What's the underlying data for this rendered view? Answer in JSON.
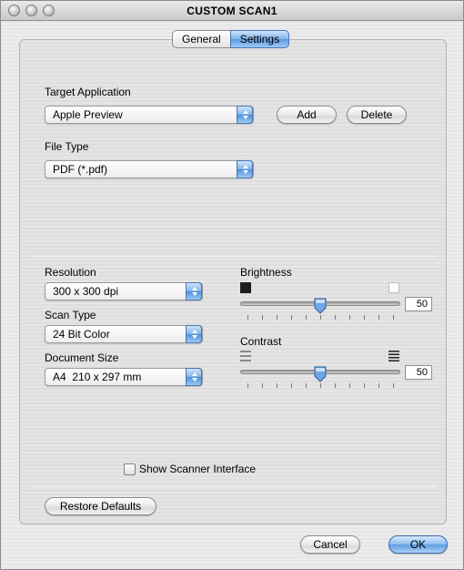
{
  "window": {
    "title": "CUSTOM SCAN1"
  },
  "tabs": [
    {
      "label": "General",
      "selected": false
    },
    {
      "label": "Settings",
      "selected": true
    }
  ],
  "target_application": {
    "label": "Target Application",
    "value": "Apple Preview",
    "add": "Add",
    "delete": "Delete"
  },
  "file_type": {
    "label": "File Type",
    "value": "PDF (*.pdf)"
  },
  "resolution": {
    "label": "Resolution",
    "value": "300 x 300 dpi"
  },
  "scan_type": {
    "label": "Scan Type",
    "value": "24 Bit Color"
  },
  "document_size": {
    "label": "Document Size",
    "value": "A4  210 x 297 mm"
  },
  "brightness": {
    "label": "Brightness",
    "value": "50",
    "level": 0.5
  },
  "contrast": {
    "label": "Contrast",
    "value": "50",
    "level": 0.5
  },
  "show_scanner_interface": {
    "label": "Show Scanner Interface",
    "checked": false
  },
  "buttons": {
    "restore_defaults": "Restore Defaults",
    "cancel": "Cancel",
    "ok": "OK"
  },
  "colors": {
    "accent": "#5a99e1",
    "default_button": "#5c9ce4"
  }
}
